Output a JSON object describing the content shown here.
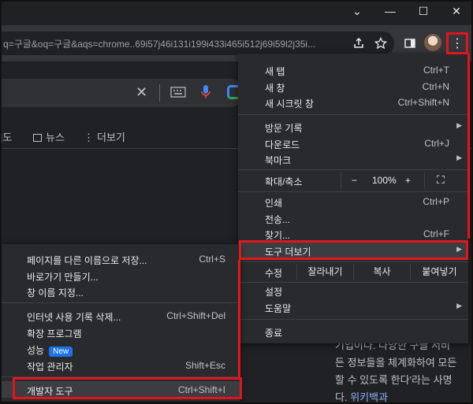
{
  "titlebar": {
    "minimize": "⌄",
    "min": "—",
    "max": "☐",
    "close": "✕"
  },
  "omnibox": {
    "url": "q=구글&oq=구글&aqs=chrome..69i57j46i131i199i433i465i512j69i59l2j35i..."
  },
  "toolbar_icons": [
    "share-icon",
    "star-icon",
    "sidebar-icon",
    "profile-avatar",
    "menu-icon"
  ],
  "search": {
    "close": "✕"
  },
  "tabs": {
    "partial": "|도",
    "news": "뉴스",
    "more": "더보기"
  },
  "right_text": {
    "line1": "기업이다. 다양한 구글 서비",
    "line2": "든 정보들을 체계화하여 모든",
    "line3": "할 수 있도록 한다'라는 사명",
    "line4_prefix": "다. ",
    "line4_link": "위키백과"
  },
  "main_menu": {
    "new_tab": {
      "label": "새 탭",
      "shortcut": "Ctrl+T"
    },
    "new_window": {
      "label": "새 창",
      "shortcut": "Ctrl+N"
    },
    "new_incognito": {
      "label": "새 시크릿 창",
      "shortcut": "Ctrl+Shift+N"
    },
    "history": {
      "label": "방문 기록"
    },
    "downloads": {
      "label": "다운로드",
      "shortcut": "Ctrl+J"
    },
    "bookmarks": {
      "label": "북마크"
    },
    "zoom": {
      "label": "확대/축소",
      "minus": "−",
      "value": "100%",
      "plus": "+",
      "fullscreen": "⛶"
    },
    "print": {
      "label": "인쇄",
      "shortcut": "Ctrl+P"
    },
    "cast": {
      "label": "전송..."
    },
    "find": {
      "label": "찾기...",
      "shortcut": "Ctrl+F"
    },
    "more_tools": {
      "label": "도구 더보기"
    },
    "edit": {
      "label": "수정",
      "cut": "잘라내기",
      "copy": "복사",
      "paste": "붙여넣기"
    },
    "settings": {
      "label": "설정"
    },
    "help": {
      "label": "도움말"
    },
    "exit": {
      "label": "종료"
    }
  },
  "sub_menu": {
    "save_page": {
      "label": "페이지를 다른 이름으로 저장...",
      "shortcut": "Ctrl+S"
    },
    "create_shortcut": {
      "label": "바로가기 만들기..."
    },
    "name_window": {
      "label": "창 이름 지정..."
    },
    "clear_data": {
      "label": "인터넷 사용 기록 삭제...",
      "shortcut": "Ctrl+Shift+Del"
    },
    "extensions": {
      "label": "확장 프로그램"
    },
    "performance": {
      "label": "성능",
      "badge": "New"
    },
    "task_manager": {
      "label": "작업 관리자",
      "shortcut": "Shift+Esc"
    },
    "dev_tools": {
      "label": "개발자 도구",
      "shortcut": "Ctrl+Shift+I"
    }
  },
  "colors": {
    "highlight": "#e0161e",
    "menu_bg": "#292a2d",
    "badge": "#1a73e8"
  }
}
